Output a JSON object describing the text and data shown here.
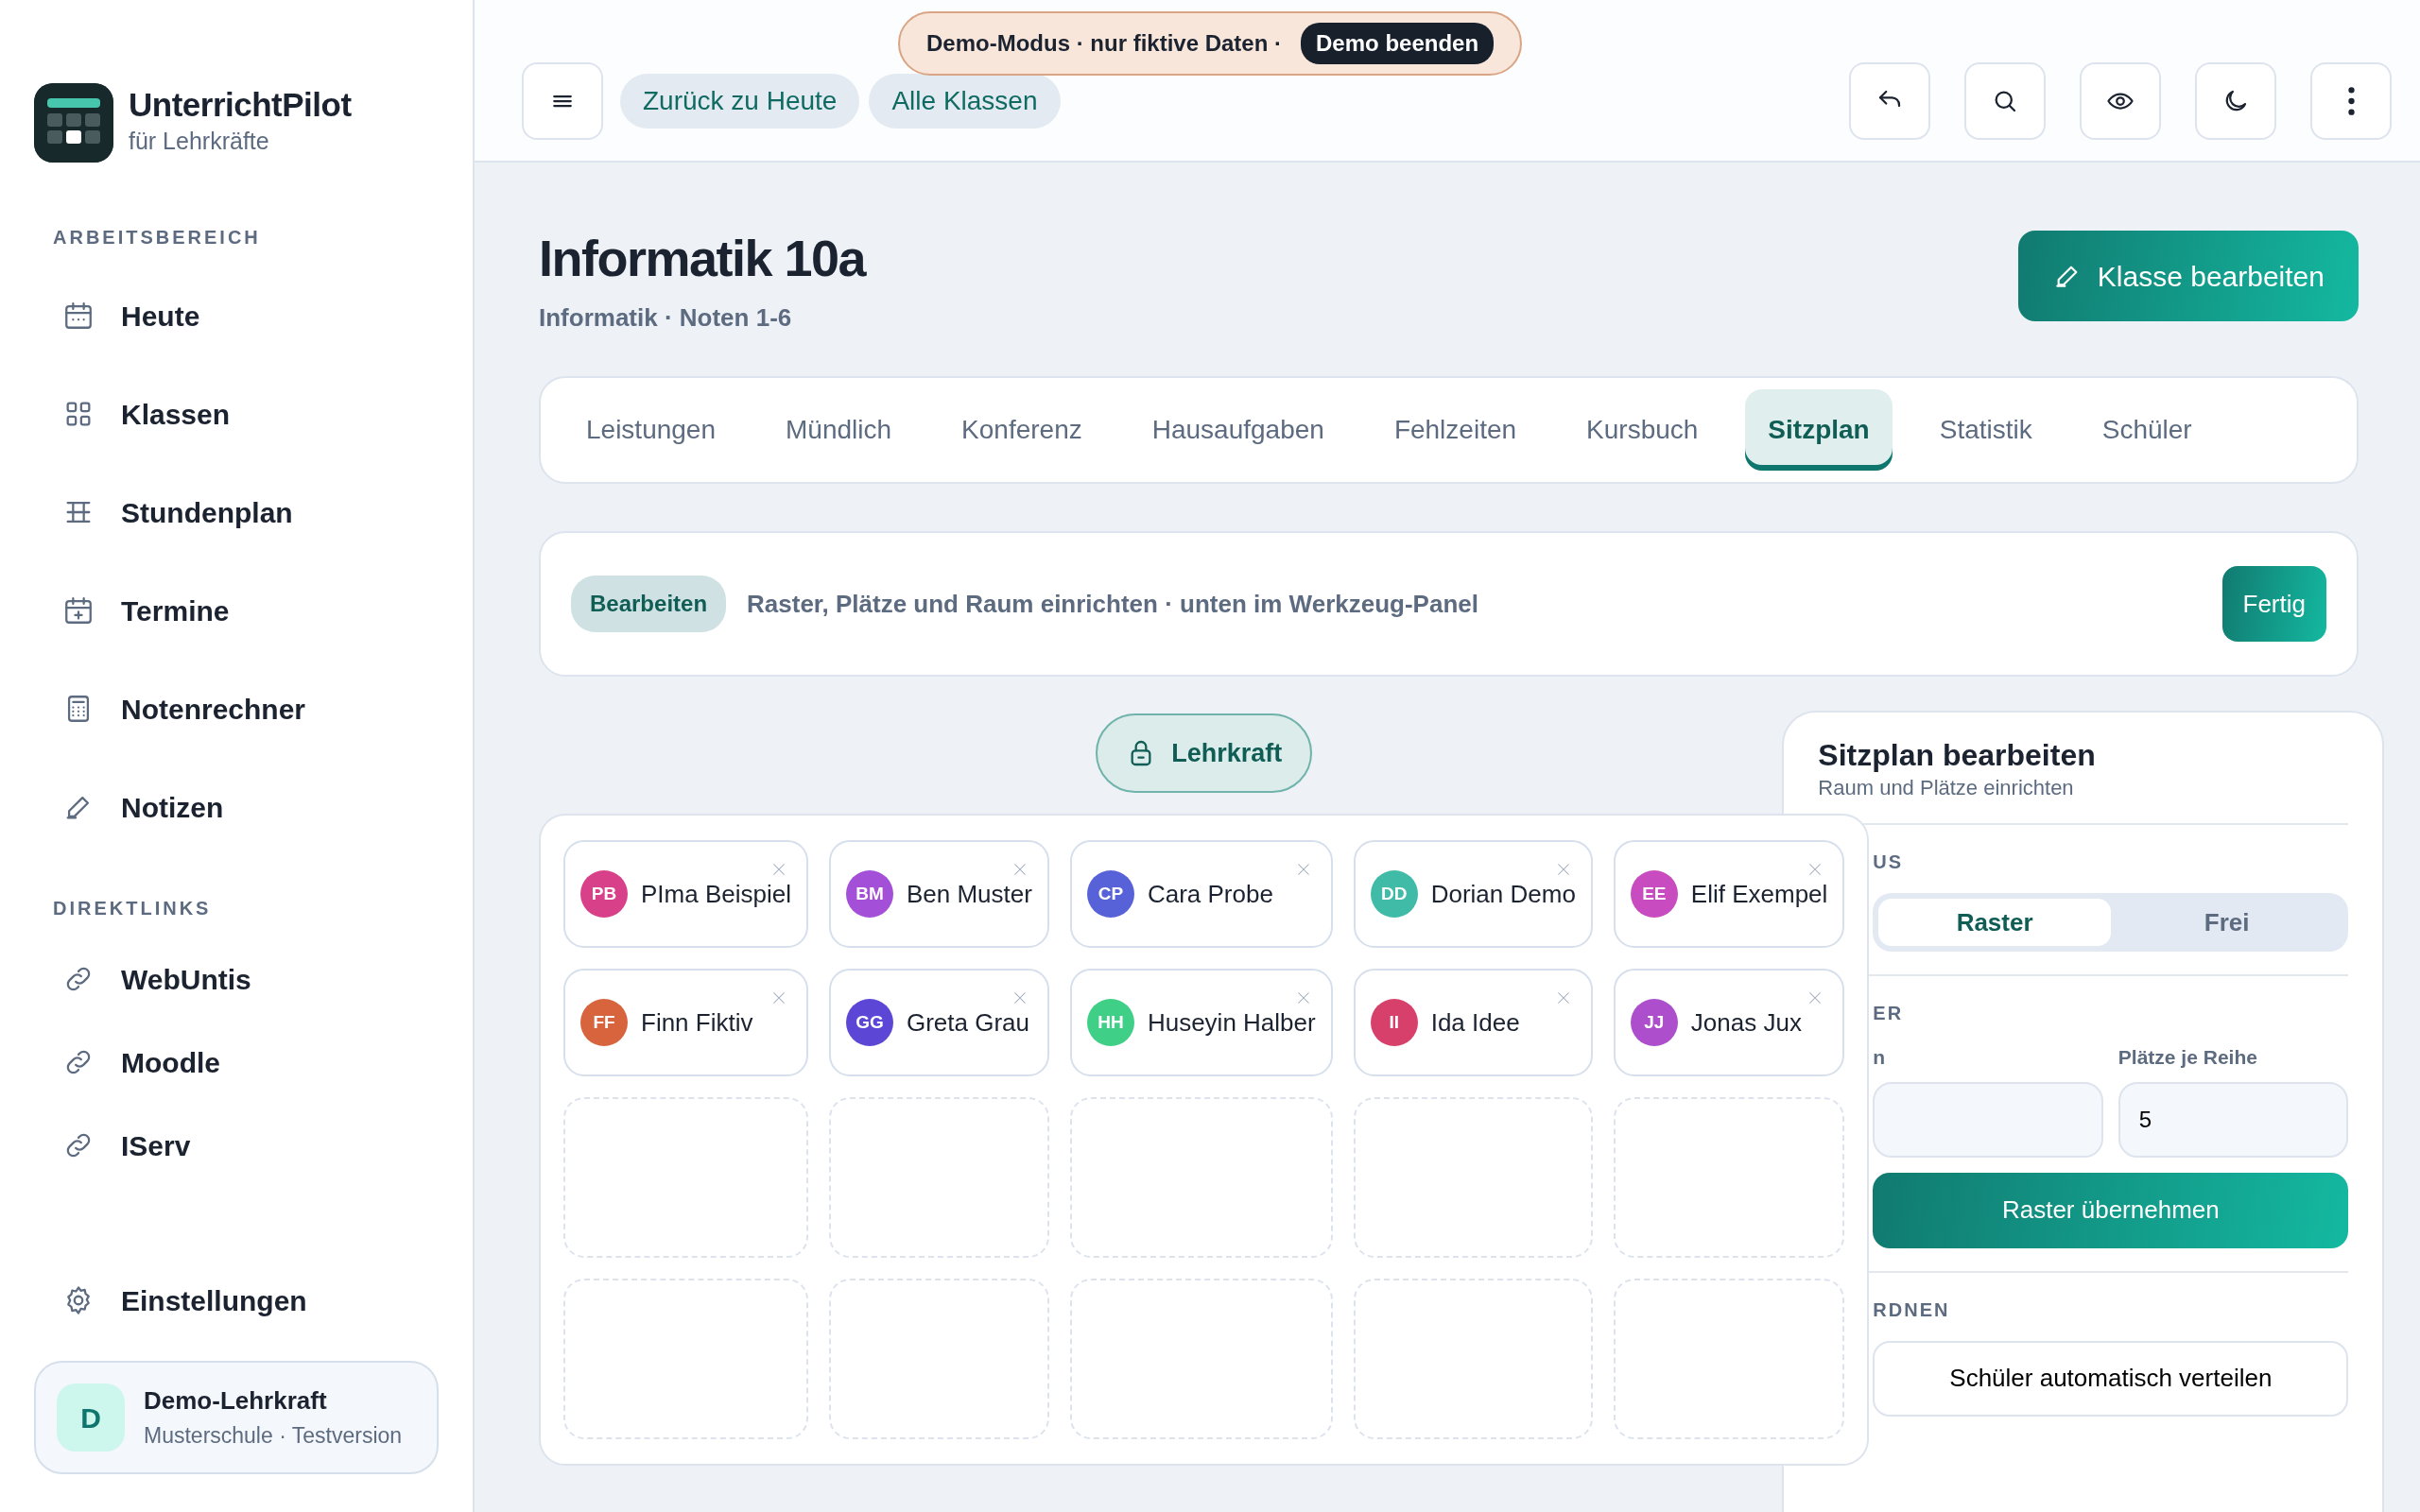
{
  "sidebar": {
    "brand": {
      "title": "UnterrichtPilot",
      "subtitle": "für Lehrkräfte"
    },
    "sections": [
      {
        "title": "ARBEITSBEREICH",
        "items": [
          {
            "label": "Heute"
          },
          {
            "label": "Klassen"
          },
          {
            "label": "Stundenplan"
          },
          {
            "label": "Termine"
          },
          {
            "label": "Notenrechner"
          },
          {
            "label": "Notizen"
          }
        ]
      },
      {
        "title": "DIREKTLINKS",
        "items": [
          {
            "label": "WebUntis"
          },
          {
            "label": "Moodle"
          },
          {
            "label": "IServ"
          }
        ]
      }
    ],
    "settings": "Einstellungen",
    "profile": {
      "initial": "D",
      "name": "Demo-Lehrkraft",
      "detail": "Musterschule · Testversion"
    }
  },
  "topbar": {
    "nav_pills": [
      "Zurück zu Heute",
      "Alle Klassen"
    ],
    "demo_banner": {
      "text": "Demo-Modus · nur fiktive Daten ·",
      "button": "Demo beenden"
    }
  },
  "header": {
    "title": "Informatik 10a",
    "subtitle": "Informatik · Noten 1-6",
    "edit_button": "Klasse bearbeiten"
  },
  "tabs": [
    {
      "label": "Leistungen",
      "selected": false
    },
    {
      "label": "Mündlich",
      "selected": false
    },
    {
      "label": "Konferenz",
      "selected": false
    },
    {
      "label": "Hausaufgaben",
      "selected": false
    },
    {
      "label": "Fehlzeiten",
      "selected": false
    },
    {
      "label": "Kursbuch",
      "selected": false
    },
    {
      "label": "Sitzplan",
      "selected": true
    },
    {
      "label": "Statistik",
      "selected": false
    },
    {
      "label": "Schüler",
      "selected": false
    }
  ],
  "edit_banner": {
    "badge": "Bearbeiten",
    "text": "Raster, Plätze und Raum einrichten · unten im Werkzeug-Panel",
    "button": "Fertig"
  },
  "teacher_desk": "Lehrkraft",
  "seat_rows": [
    [
      {
        "kind": "student",
        "initials": "PB",
        "name": "PIma Beispiel",
        "color": "#d9408a"
      },
      {
        "kind": "student",
        "initials": "BM",
        "name": "Ben Muster",
        "color": "#a44fd8"
      },
      {
        "kind": "student",
        "initials": "CP",
        "name": "Cara Probe",
        "color": "#5862d8"
      },
      {
        "kind": "student",
        "initials": "DD",
        "name": "Dorian Demo",
        "color": "#3fbba8"
      },
      {
        "kind": "student",
        "initials": "EE",
        "name": "Elif Exempel",
        "color": "#c84cbf"
      }
    ],
    [
      {
        "kind": "student",
        "initials": "FF",
        "name": "Finn Fiktiv",
        "color": "#d8643e"
      },
      {
        "kind": "student",
        "initials": "GG",
        "name": "Greta Grau",
        "color": "#5c46d6"
      },
      {
        "kind": "student",
        "initials": "HH",
        "name": "Huseyin Halber",
        "color": "#3fcf86"
      },
      {
        "kind": "student",
        "initials": "II",
        "name": "Ida Idee",
        "color": "#d8406c"
      },
      {
        "kind": "student",
        "initials": "JJ",
        "name": "Jonas Jux",
        "color": "#ad4fcc"
      }
    ],
    [
      {
        "kind": "empty"
      },
      {
        "kind": "empty"
      },
      {
        "kind": "empty"
      },
      {
        "kind": "empty"
      },
      {
        "kind": "empty"
      }
    ],
    [
      {
        "kind": "empty"
      },
      {
        "kind": "empty"
      },
      {
        "kind": "empty"
      },
      {
        "kind": "empty"
      },
      {
        "kind": "empty"
      }
    ]
  ],
  "panel": {
    "title": "Sitzplan bearbeiten",
    "subtitle": "Raum und Plätze einrichten",
    "mode_label": "US",
    "modes": [
      {
        "label": "Raster",
        "selected": true
      },
      {
        "label": "Frei",
        "selected": false
      }
    ],
    "grid_label": "ER",
    "fields": [
      {
        "label": "n"
      },
      {
        "label": "Plätze je Reihe",
        "value": "5"
      }
    ],
    "apply_button": "Raster übernehmen",
    "arrange_label": "RDNEN",
    "auto_button": "Schüler automatisch verteilen"
  }
}
